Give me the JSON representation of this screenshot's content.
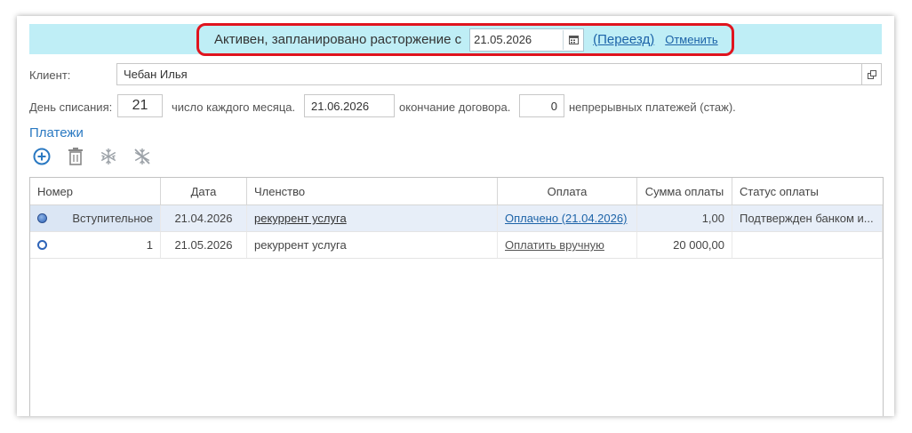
{
  "banner": {
    "status_text": "Активен, запланировано расторжение с",
    "termination_date": "21.05.2026",
    "move_link": "(Переезд)",
    "cancel_link": "Отменить"
  },
  "client": {
    "label": "Клиент:",
    "value": "Чебан Илья"
  },
  "billing": {
    "day_label": "День списания:",
    "day_value": "21",
    "month_label": "число каждого месяца.",
    "end_date": "21.06.2026",
    "end_label": "окончание договора.",
    "streak_value": "0",
    "streak_label": "непрерывных платежей (стаж)."
  },
  "payments": {
    "title": "Платежи",
    "toolbar": [
      "add-icon",
      "delete-icon",
      "freeze-icon",
      "unfreeze-icon"
    ],
    "columns": [
      "Номер",
      "Дата",
      "Членство",
      "Оплата",
      "Сумма оплаты",
      "Статус оплаты"
    ],
    "rows": [
      {
        "number": "Вступительное",
        "date": "21.04.2026",
        "membership": "рекуррент услуга",
        "payment": "Оплачено (21.04.2026)",
        "amount": "1,00",
        "status": "Подтвержден банком и..."
      },
      {
        "number": "1",
        "date": "21.05.2026",
        "membership": "рекуррент услуга",
        "payment": "Оплатить вручную",
        "amount": "20 000,00",
        "status": ""
      }
    ]
  },
  "colors": {
    "banner_bg": "#bfeef6",
    "highlight_border": "#e0141e",
    "link": "#1c63a8",
    "accent": "#2a79c2"
  }
}
